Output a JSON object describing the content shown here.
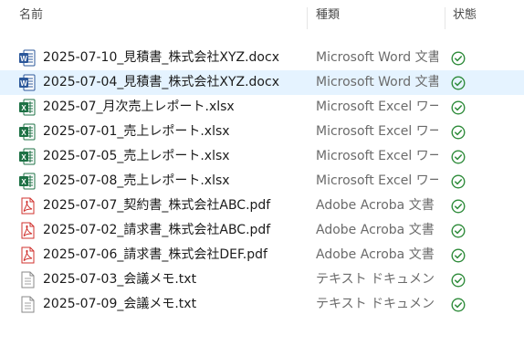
{
  "header": {
    "name": "名前",
    "type": "種類",
    "status": "状態"
  },
  "colors": {
    "selected_row": "#e5f3ff",
    "synced_green": "#2e8b3a",
    "word_blue": "#2b579a",
    "excel_green": "#1e7145",
    "pdf_red": "#d0312d"
  },
  "files": [
    {
      "name": "2025-07-10_見積書_株式会社XYZ.docx",
      "type": "Microsoft Word 文書",
      "icon": "word-icon",
      "status_icon": "synced-check-icon"
    },
    {
      "name": "2025-07-04_見積書_株式会社XYZ.docx",
      "type": "Microsoft Word 文書",
      "icon": "word-icon",
      "status_icon": "synced-check-icon",
      "selected": true
    },
    {
      "name": "2025-07_月次売上レポート.xlsx",
      "type": "Microsoft Excel ワークシート",
      "icon": "excel-icon",
      "status_icon": "synced-check-icon"
    },
    {
      "name": "2025-07-01_売上レポート.xlsx",
      "type": "Microsoft Excel ワークシート",
      "icon": "excel-icon",
      "status_icon": "synced-check-icon"
    },
    {
      "name": "2025-07-05_売上レポート.xlsx",
      "type": "Microsoft Excel ワークシート",
      "icon": "excel-icon",
      "status_icon": "synced-check-icon"
    },
    {
      "name": "2025-07-08_売上レポート.xlsx",
      "type": "Microsoft Excel ワークシート",
      "icon": "excel-icon",
      "status_icon": "synced-check-icon"
    },
    {
      "name": "2025-07-07_契約書_株式会社ABC.pdf",
      "type": "Adobe Acroba 文書",
      "icon": "pdf-icon",
      "status_icon": "synced-check-icon"
    },
    {
      "name": "2025-07-02_請求書_株式会社ABC.pdf",
      "type": "Adobe Acroba 文書",
      "icon": "pdf-icon",
      "status_icon": "synced-check-icon"
    },
    {
      "name": "2025-07-06_請求書_株式会社DEF.pdf",
      "type": "Adobe Acroba 文書",
      "icon": "pdf-icon",
      "status_icon": "synced-check-icon"
    },
    {
      "name": "2025-07-03_会議メモ.txt",
      "type": "テキスト ドキュメント",
      "icon": "text-file-icon",
      "status_icon": "synced-check-icon"
    },
    {
      "name": "2025-07-09_会議メモ.txt",
      "type": "テキスト ドキュメント",
      "icon": "text-file-icon",
      "status_icon": "synced-check-icon"
    }
  ]
}
